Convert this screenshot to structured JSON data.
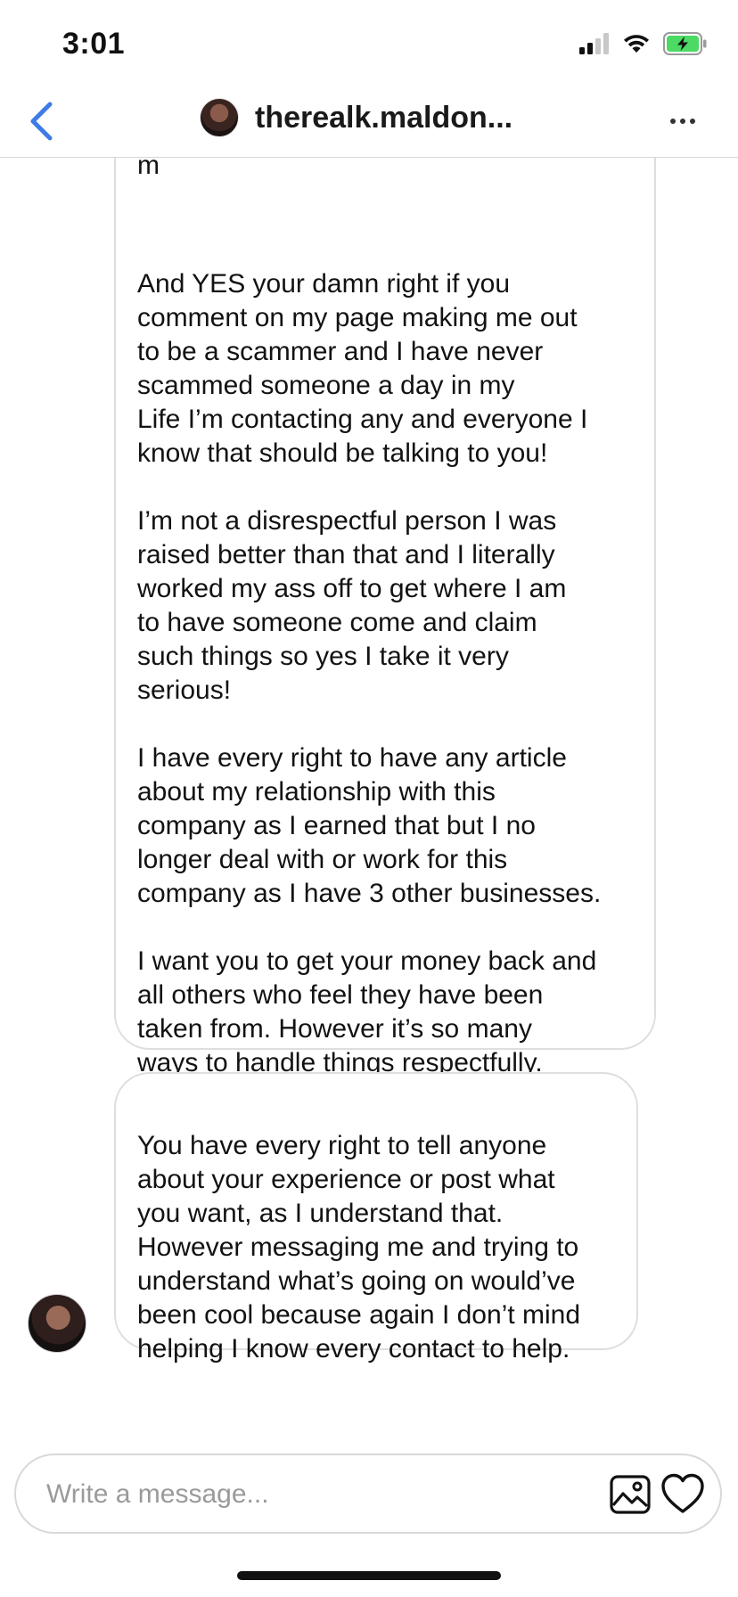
{
  "status_bar": {
    "time": "3:01",
    "icons": [
      "cellular-signal-icon",
      "wifi-icon",
      "battery-charging-icon"
    ],
    "battery_color": "#4cd964"
  },
  "header": {
    "back_icon": "chevron-left-icon",
    "username": "therealk.maldon...",
    "more_icon": "ellipsis-icon",
    "accent_color": "#3e7be6"
  },
  "messages": [
    {
      "tail_text": "m",
      "paragraphs": [
        "And YES your damn right if you\ncomment on my page making me out\nto be a scammer and I have never\nscammed someone a day in my\nLife I’m contacting any and everyone I\nknow that should be talking to you!",
        "I’m not a disrespectful person I was\nraised better than that and I literally\nworked my ass off to get where I am\nto have someone come and claim\nsuch things so yes I take it very\nserious!",
        "I have every right to have any article\nabout my relationship with this\ncompany as I earned that but I no\nlonger deal with or work for this\ncompany as I have 3 other businesses.",
        "I want you to get your money back and\nall others who feel they have been\ntaken from. However it’s so many\nways to handle things respectfully."
      ]
    },
    {
      "text": "You have every right to tell anyone\nabout your experience or post what\nyou want, as I understand that.\nHowever messaging me and trying to\nunderstand what’s going on would’ve\nbeen cool because again I don’t mind\nhelping I know every contact to help."
    }
  ],
  "composer": {
    "placeholder": "Write a message...",
    "value": "",
    "image_icon": "image-icon",
    "heart_icon": "heart-icon"
  }
}
